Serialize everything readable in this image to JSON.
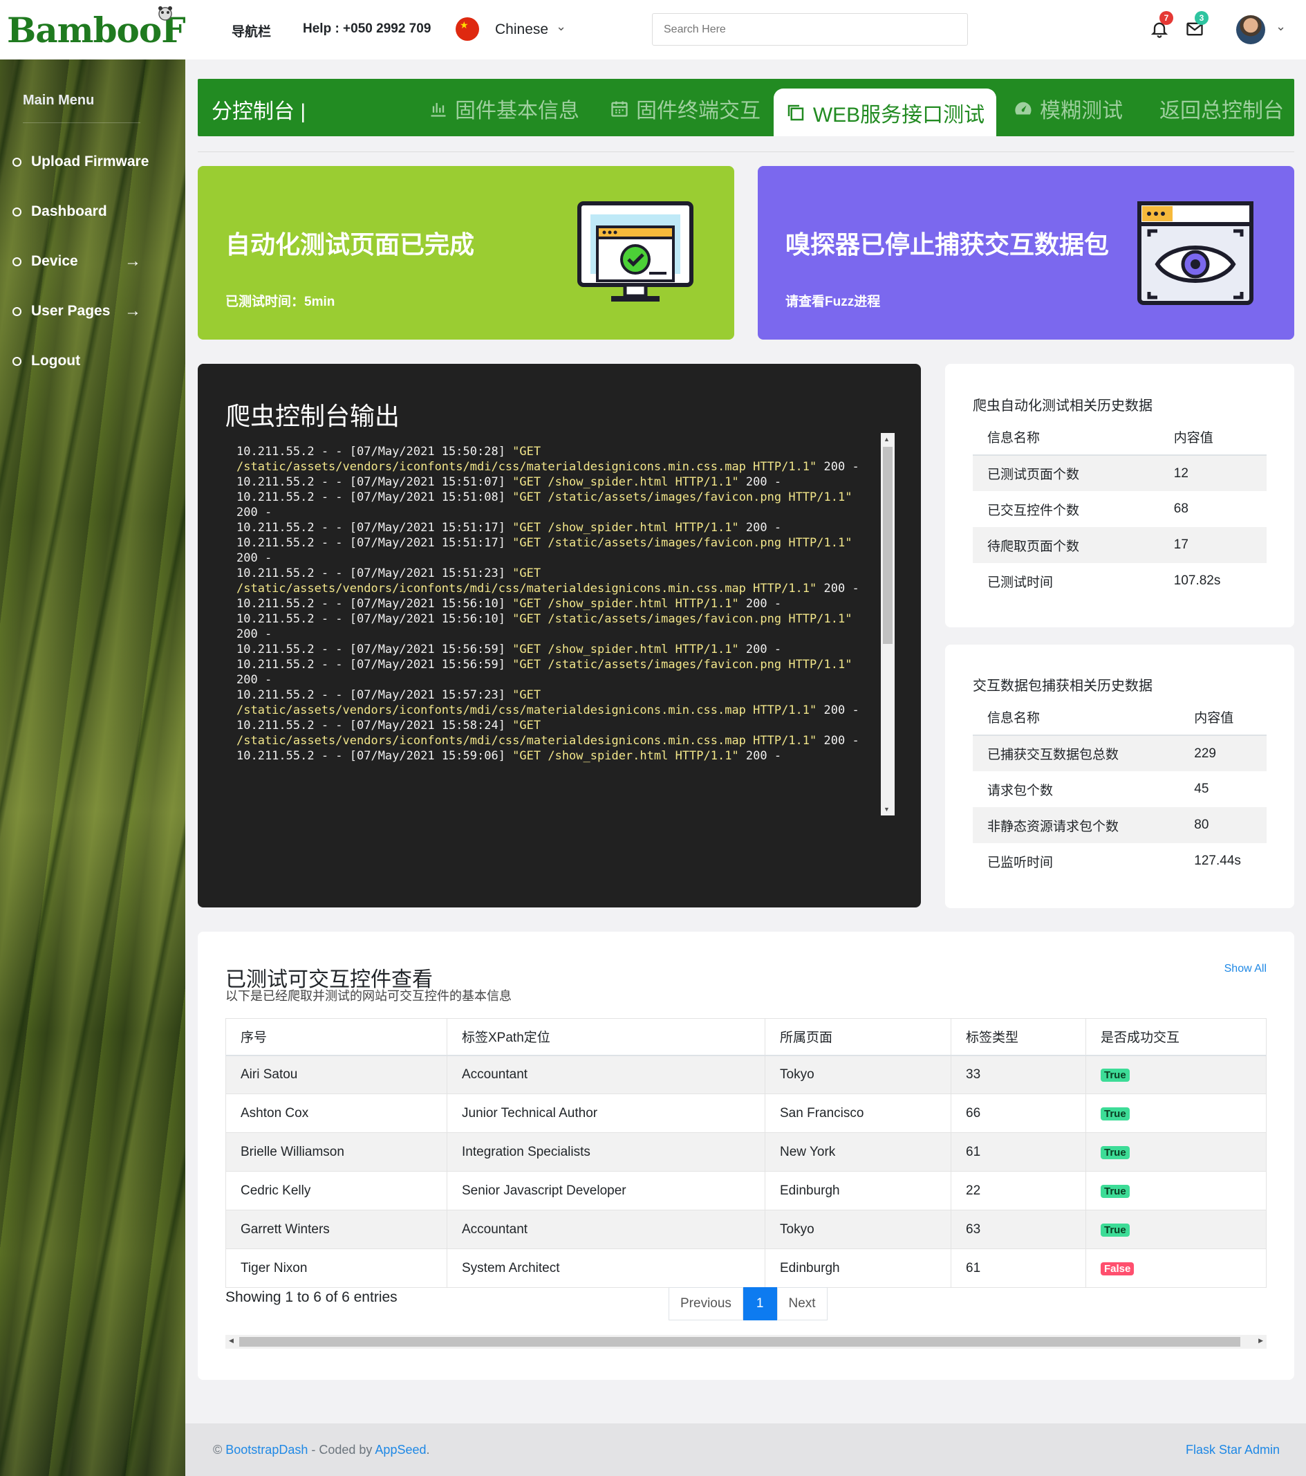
{
  "brand": {
    "name": "BambooFuzz"
  },
  "sidebar": {
    "title": "Main Menu",
    "items": [
      {
        "label": "Upload Firmware",
        "has_arrow": false
      },
      {
        "label": "Dashboard",
        "has_arrow": false
      },
      {
        "label": "Device",
        "has_arrow": true
      },
      {
        "label": "User Pages",
        "has_arrow": true
      },
      {
        "label": "Logout",
        "has_arrow": false
      }
    ]
  },
  "navbar": {
    "nav_label": "导航栏",
    "help": "Help : +050 2992 709",
    "language": "Chinese",
    "search_placeholder": "Search Here",
    "notifications_count": "7",
    "messages_count": "3"
  },
  "tabs": {
    "home": "分控制台 |",
    "items": [
      {
        "label": "固件基本信息",
        "icon": "bar-chart-icon"
      },
      {
        "label": "固件终端交互",
        "icon": "calendar-icon"
      },
      {
        "label": "WEB服务接口测试",
        "icon": "copy-icon",
        "active": true
      },
      {
        "label": "模糊测试",
        "icon": "speedometer-icon"
      },
      {
        "label": "返回总控制台",
        "icon": ""
      }
    ]
  },
  "hero_cards": [
    {
      "title": "自动化测试页面已完成",
      "subtitle": "已测试时间：5min",
      "color": "#9acd32",
      "icon": "monitor-check-icon"
    },
    {
      "title": "嗅探器已停止捕获交互数据包",
      "subtitle": "请查看Fuzz进程",
      "color": "#7b68ee",
      "icon": "browser-eye-icon"
    }
  ],
  "console": {
    "title": "爬虫控制台输出",
    "lines": [
      "10.211.55.2 - - [07/May/2021 15:50:28] \"GET /static/assets/vendors/iconfonts/mdi/css/materialdesignicons.min.css.map HTTP/1.1\" 200 -",
      "10.211.55.2 - - [07/May/2021 15:51:07] \"GET /show_spider.html HTTP/1.1\" 200 -",
      "10.211.55.2 - - [07/May/2021 15:51:08] \"GET /static/assets/images/favicon.png HTTP/1.1\" 200 -",
      "10.211.55.2 - - [07/May/2021 15:51:17] \"GET /show_spider.html HTTP/1.1\" 200 -",
      "10.211.55.2 - - [07/May/2021 15:51:17] \"GET /static/assets/images/favicon.png HTTP/1.1\" 200 -",
      "10.211.55.2 - - [07/May/2021 15:51:23] \"GET /static/assets/vendors/iconfonts/mdi/css/materialdesignicons.min.css.map HTTP/1.1\" 200 -",
      "10.211.55.2 - - [07/May/2021 15:56:10] \"GET /show_spider.html HTTP/1.1\" 200 -",
      "10.211.55.2 - - [07/May/2021 15:56:10] \"GET /static/assets/images/favicon.png HTTP/1.1\" 200 -",
      "10.211.55.2 - - [07/May/2021 15:56:59] \"GET /show_spider.html HTTP/1.1\" 200 -",
      "10.211.55.2 - - [07/May/2021 15:56:59] \"GET /static/assets/images/favicon.png HTTP/1.1\" 200 -",
      "10.211.55.2 - - [07/May/2021 15:57:23] \"GET /static/assets/vendors/iconfonts/mdi/css/materialdesignicons.min.css.map HTTP/1.1\" 200 -",
      "10.211.55.2 - - [07/May/2021 15:58:24] \"GET /static/assets/vendors/iconfonts/mdi/css/materialdesignicons.min.css.map HTTP/1.1\" 200 -",
      "10.211.55.2 - - [07/May/2021 15:59:06] \"GET /show_spider.html HTTP/1.1\" 200 -"
    ]
  },
  "spider_stats": {
    "title": "爬虫自动化测试相关历史数据",
    "col_name": "信息名称",
    "col_value": "内容值",
    "rows": [
      {
        "name": "已测试页面个数",
        "value": "12"
      },
      {
        "name": "已交互控件个数",
        "value": "68"
      },
      {
        "name": "待爬取页面个数",
        "value": "17"
      },
      {
        "name": "已测试时间",
        "value": "107.82s"
      }
    ]
  },
  "sniffer_stats": {
    "title": "交互数据包捕获相关历史数据",
    "col_name": "信息名称",
    "col_value": "内容值",
    "rows": [
      {
        "name": "已捕获交互数据包总数",
        "value": "229"
      },
      {
        "name": "请求包个数",
        "value": "45"
      },
      {
        "name": "非静态资源请求包个数",
        "value": "80"
      },
      {
        "name": "已监听时间",
        "value": "127.44s"
      }
    ]
  },
  "controls_table": {
    "title": "已测试可交互控件查看",
    "description": "以下是已经爬取并测试的网站可交互控件的基本信息",
    "show_all": "Show All",
    "headers": [
      "序号",
      "标签XPath定位",
      "所属页面",
      "标签类型",
      "是否成功交互"
    ],
    "rows": [
      [
        "Airi Satou",
        "Accountant",
        "Tokyo",
        "33",
        "True"
      ],
      [
        "Ashton Cox",
        "Junior Technical Author",
        "San Francisco",
        "66",
        "True"
      ],
      [
        "Brielle Williamson",
        "Integration Specialists",
        "New York",
        "61",
        "True"
      ],
      [
        "Cedric Kelly",
        "Senior Javascript Developer",
        "Edinburgh",
        "22",
        "True"
      ],
      [
        "Garrett Winters",
        "Accountant",
        "Tokyo",
        "63",
        "True"
      ],
      [
        "Tiger Nixon",
        "System Architect",
        "Edinburgh",
        "61",
        "False"
      ]
    ],
    "info": "Showing 1 to 6 of 6 entries",
    "pager": {
      "prev": "Previous",
      "current": "1",
      "next": "Next"
    }
  },
  "footer": {
    "copyright": "©",
    "brand_link": "BootstrapDash",
    "coded_by": " - Coded by ",
    "author_link": "AppSeed",
    "period": ".",
    "right_link": "Flask Star Admin"
  }
}
